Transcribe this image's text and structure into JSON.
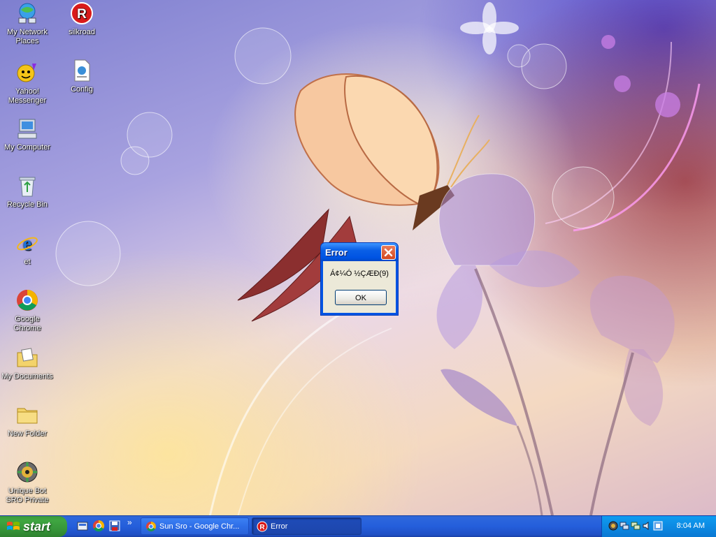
{
  "desktop": {
    "icons": [
      {
        "label": "My Network Places",
        "icon": "network-places-icon"
      },
      {
        "label": "silkroad",
        "icon": "silkroad-icon"
      },
      {
        "label": "Yahoo! Messenger",
        "icon": "yahoo-messenger-icon"
      },
      {
        "label": "Config",
        "icon": "config-file-icon"
      },
      {
        "label": "My Computer",
        "icon": "my-computer-icon"
      },
      {
        "label": "Recycle Bin",
        "icon": "recycle-bin-icon"
      },
      {
        "label": "et",
        "icon": "internet-explorer-icon"
      },
      {
        "label": "Google Chrome",
        "icon": "chrome-icon"
      },
      {
        "label": "My Documents",
        "icon": "my-documents-icon"
      },
      {
        "label": "New Folder",
        "icon": "folder-icon"
      },
      {
        "label": "Unique Bot SRO Private",
        "icon": "unique-bot-icon"
      }
    ]
  },
  "dialog": {
    "title": "Error",
    "message": "Á¢¼Ó ½ÇÆÐ(9)",
    "ok_label": "OK",
    "close_icon": "close-icon"
  },
  "taskbar": {
    "start_label": "start",
    "quick_launch": [
      "show-desktop-icon",
      "chrome-icon",
      "save-icon"
    ],
    "chevron": "»",
    "tasks": [
      {
        "label": "Sun Sro - Google Chr...",
        "icon": "chrome-icon",
        "active": false
      },
      {
        "label": "Error",
        "icon": "silkroad-icon",
        "active": true
      }
    ],
    "tray_icons": [
      "bot-tray-icon",
      "network-tray-icon",
      "network-tray-icon-2",
      "speaker-tray-icon",
      "app-tray-icon"
    ],
    "clock": "8:04 AM"
  },
  "colors": {
    "taskbar_blue": "#245edb",
    "start_green": "#3fa641",
    "tray_blue": "#0c8ae3",
    "dialog_face": "#ece9d8",
    "close_red": "#d3471f"
  }
}
